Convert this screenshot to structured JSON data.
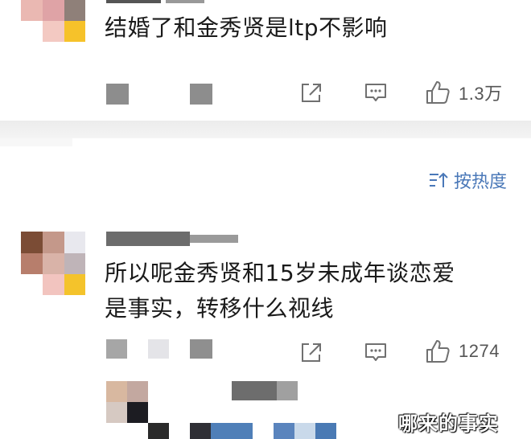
{
  "comments": [
    {
      "text": "结婚了和金秀贤是ltp不影响",
      "like_count": "1.3万"
    },
    {
      "text_line1": "所以呢金秀贤和15岁未成年谈恋爱",
      "text_line2": "是事实，转移什么视线",
      "like_count": "1274"
    }
  ],
  "sort": {
    "label": "按热度",
    "icon": "sort-icon"
  },
  "icons": {
    "share": "share-icon",
    "reply": "comment-icon",
    "like": "thumbs-up-icon"
  },
  "watermark": "哪来的事实",
  "colors": {
    "text": "#1a1a1a",
    "accent": "#4a78b8",
    "icon": "#6b6b6b"
  }
}
